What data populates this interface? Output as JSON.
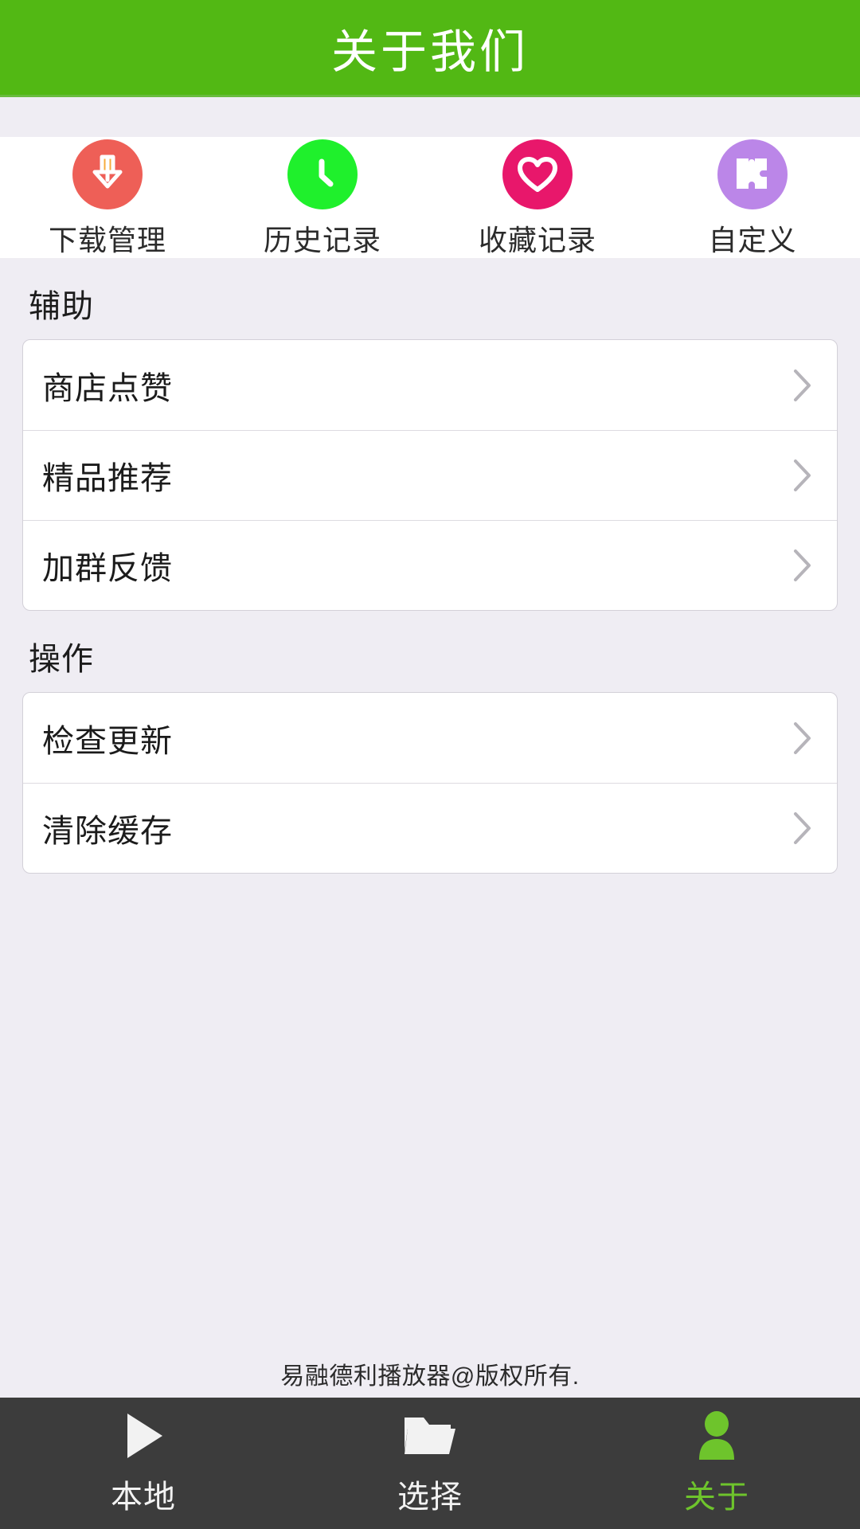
{
  "header": {
    "title": "关于我们",
    "bg_color": "#52b814",
    "text_color": "#ffffff"
  },
  "shortcuts": [
    {
      "label": "下载管理",
      "icon": "download-arrow-icon",
      "circle_color": "#ee5f57",
      "glyph_color": "#f6ab3e"
    },
    {
      "label": "历史记录",
      "icon": "clock-icon",
      "circle_color": "#1ff02c",
      "glyph_color": "#ffffff"
    },
    {
      "label": "收藏记录",
      "icon": "heart-icon",
      "circle_color": "#e8176b",
      "glyph_color": "#ffffff"
    },
    {
      "label": "自定义",
      "icon": "puzzle-piece-icon",
      "circle_color": "#bb86e8",
      "glyph_color": "#ffffff"
    }
  ],
  "sections": [
    {
      "title": "辅助",
      "rows": [
        {
          "label": "商店点赞",
          "chevron": "chevron-right-icon"
        },
        {
          "label": "精品推荐",
          "chevron": "chevron-right-icon"
        },
        {
          "label": "加群反馈",
          "chevron": "chevron-right-icon"
        }
      ]
    },
    {
      "title": "操作",
      "rows": [
        {
          "label": "检查更新",
          "chevron": "chevron-right-icon"
        },
        {
          "label": "清除缓存",
          "chevron": "chevron-right-icon"
        }
      ]
    }
  ],
  "footer": {
    "copyright": "易融德利播放器@版权所有."
  },
  "bottom_nav": {
    "active_color": "#6ec42c",
    "inactive_color": "#f2f2f2",
    "items": [
      {
        "label": "本地",
        "icon": "play-triangle-icon",
        "active": false
      },
      {
        "label": "选择",
        "icon": "folder-open-icon",
        "active": false
      },
      {
        "label": "关于",
        "icon": "person-icon",
        "active": true
      }
    ]
  }
}
